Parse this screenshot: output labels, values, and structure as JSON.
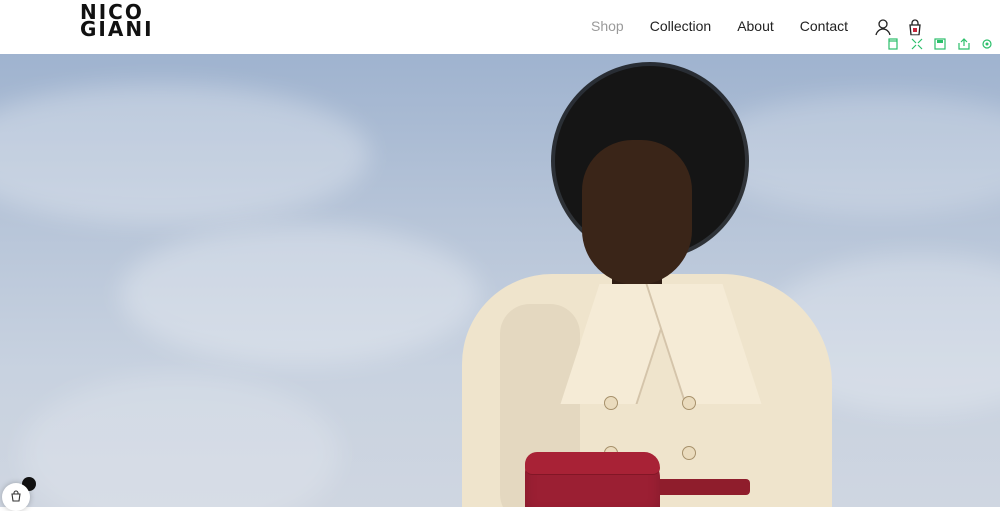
{
  "brand": {
    "logo_line1": "NICO",
    "logo_line2": "GIANI"
  },
  "nav": {
    "items": [
      "Shop",
      "Collection",
      "About",
      "Contact"
    ],
    "active": "Shop"
  },
  "header_icons": [
    "user-icon",
    "shopping-bag-icon"
  ],
  "extension_toolbar": {
    "icons": [
      "bookmark-icon",
      "expand-icon",
      "save-icon",
      "share-icon",
      "settings-icon"
    ],
    "color": "#2bbf6a"
  },
  "hero": {
    "description_icon": "hero-image"
  },
  "floating_cart": {
    "icon": "cart-icon",
    "badge_color": "#111111"
  }
}
